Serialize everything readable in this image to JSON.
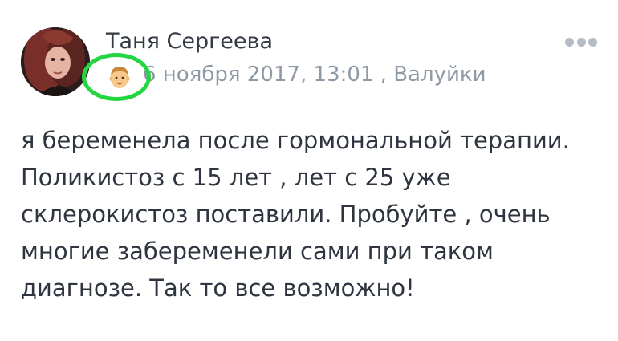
{
  "post": {
    "author": "Таня Сергеева",
    "meta": "6 ноября 2017, 13:01 , Валуйки",
    "badge_icon": "man-face-emoji-icon",
    "more_icon": "more-dots-icon",
    "body_lines": [
      "я беременела после гормональной терапии.",
      "Поликистоз с 15 лет , лет с 25 уже",
      "склерокистоз поставили. Пробуйте , очень",
      "многие забеременели сами при таком",
      "диагнозе. Так то все возможно!"
    ]
  },
  "colors": {
    "author": "#333a44",
    "meta": "#8e99a5",
    "body": "#2f3540",
    "highlight": "#22d640",
    "more_dots": "#b4bcc6"
  }
}
